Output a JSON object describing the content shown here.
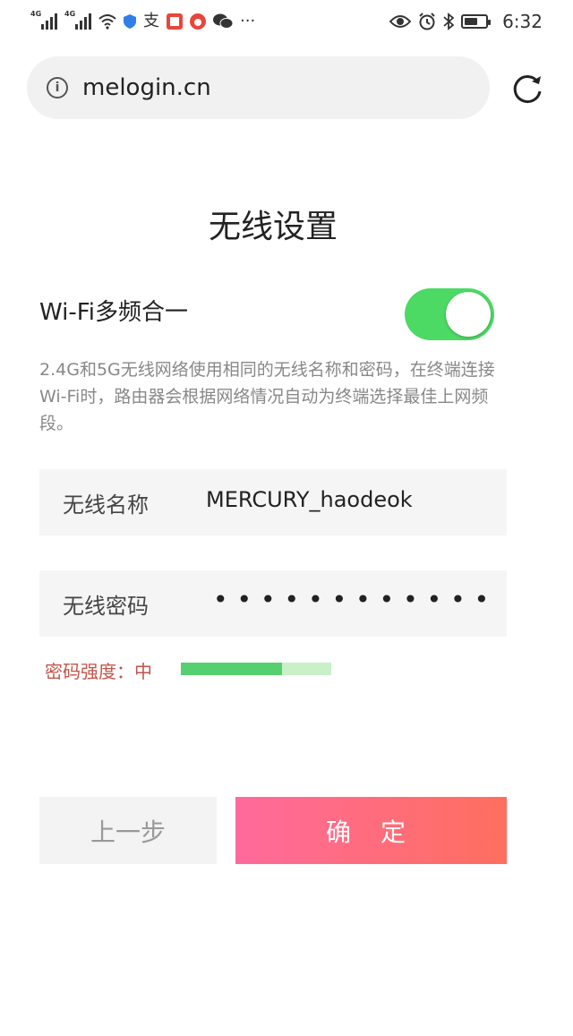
{
  "status_bar": {
    "sim1": "4G",
    "sim2": "4G",
    "more": "···",
    "time": "6:32"
  },
  "browser": {
    "url": "melogin.cn"
  },
  "page": {
    "title": "无线设置",
    "wifi_merge_label": "Wi-Fi多频合一",
    "wifi_merge_on": true,
    "description": "2.4G和5G无线网络使用相同的无线名称和密码，在终端连接Wi-Fi时，路由器会根据网络情况自动为终端选择最佳上网频段。",
    "ssid_label": "无线名称",
    "ssid_value": "MERCURY_haodeok",
    "password_label": "无线密码",
    "password_mask": "••••••••••••",
    "strength_label": "密码强度：中",
    "strength_fraction": 0.67,
    "prev_button": "上一步",
    "confirm_button": "确 定"
  },
  "colors": {
    "toggle_on": "#4cd964",
    "strength_fill": "#55d06e",
    "strength_track": "#c9f0c9",
    "strength_text": "#c0554a",
    "confirm_start": "#ff6a9c",
    "confirm_end": "#ff6f5e"
  },
  "icons": [
    "signal-icon",
    "wifi-icon",
    "shield-icon",
    "alipay-icon",
    "book-icon",
    "weibo-icon",
    "wechat-icon",
    "eye-icon",
    "alarm-icon",
    "bluetooth-icon",
    "battery-icon",
    "info-icon",
    "reload-icon"
  ]
}
